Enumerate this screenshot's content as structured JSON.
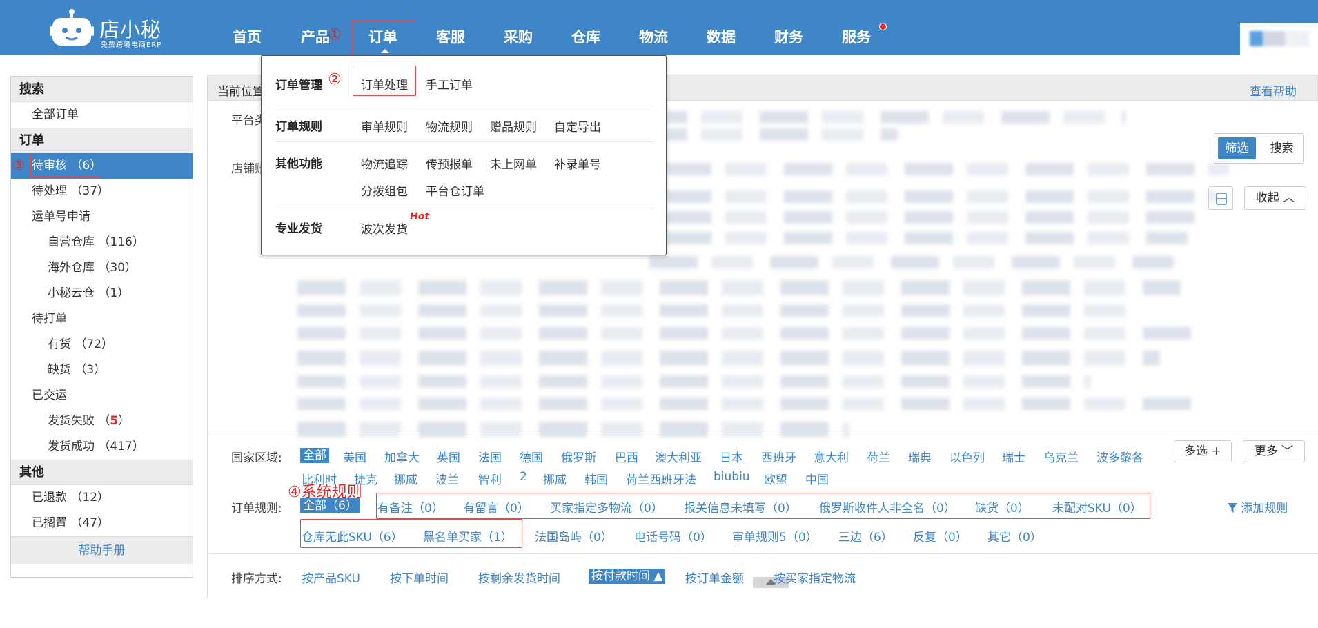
{
  "app": {
    "logo_title": "店小秘",
    "logo_subtitle": "免费跨境电商ERP"
  },
  "nav": {
    "items": [
      "首页",
      "产品",
      "订单",
      "客服",
      "采购",
      "仓库",
      "物流",
      "数据",
      "财务",
      "服务"
    ],
    "active": "订单"
  },
  "annotations": {
    "a1": "①",
    "a2": "②",
    "a3": "③",
    "a4": "④系统规则"
  },
  "dropdown": {
    "sections": [
      {
        "head": "订单管理",
        "links": [
          "订单处理",
          "手工订单"
        ]
      },
      {
        "head": "订单规则",
        "links": [
          "审单规则",
          "物流规则",
          "赠品规则",
          "自定导出"
        ]
      },
      {
        "head": "其他功能",
        "links": [
          "物流追踪",
          "传预报单",
          "未上网单",
          "补录单号",
          "分拨组包",
          "平台仓订单"
        ]
      },
      {
        "head": "专业发货",
        "links": [
          "波次发货"
        ]
      }
    ],
    "hot_badge": "Hot"
  },
  "sidebar": {
    "groups": [
      {
        "head": "搜索",
        "items": [
          {
            "label": "全部订单",
            "level": 1
          }
        ]
      },
      {
        "head": "订单",
        "items": [
          {
            "label": "待审核",
            "count": "（6）",
            "level": 1,
            "selected": true
          },
          {
            "label": "待处理",
            "count": "（37）",
            "level": 1
          },
          {
            "label": "运单号申请",
            "count": "",
            "level": 1
          },
          {
            "label": "自营仓库",
            "count": "（116）",
            "level": 2
          },
          {
            "label": "海外仓库",
            "count": "（30）",
            "level": 2
          },
          {
            "label": "小秘云仓",
            "count": "（1）",
            "level": 2
          },
          {
            "label": "待打单",
            "count": "",
            "level": 1
          },
          {
            "label": "有货",
            "count": "（72）",
            "level": 2
          },
          {
            "label": "缺货",
            "count": "（3）",
            "level": 2
          },
          {
            "label": "已交运",
            "count": "",
            "level": 1
          },
          {
            "label": "发货失败",
            "count": "5",
            "level": 2,
            "red": true
          },
          {
            "label": "发货成功",
            "count": "（417）",
            "level": 2
          }
        ]
      },
      {
        "head": "其他",
        "items": [
          {
            "label": "已退款",
            "count": "（12）",
            "level": 1
          },
          {
            "label": "已搁置",
            "count": "（47）",
            "level": 1
          }
        ]
      }
    ],
    "footer": "帮助手册"
  },
  "main": {
    "breadcrumb": "当前位置",
    "help_link": "查看帮助",
    "platform_label": "平台类",
    "shop_label": "店铺账",
    "filter_btn": "筛选",
    "search_btn": "搜索",
    "collapse_btn": "收起 ︿",
    "country_label": "国家区域:",
    "countries_row1": [
      "全部",
      "美国",
      "加拿大",
      "英国",
      "法国",
      "德国",
      "俄罗斯",
      "巴西",
      "澳大利亚",
      "日本",
      "西班牙",
      "意大利",
      "荷兰",
      "瑞典",
      "以色列",
      "瑞士",
      "乌克兰",
      "波多黎各"
    ],
    "countries_row2": [
      "比利时",
      "捷克",
      "挪威",
      "波兰",
      "智利",
      "2",
      "挪威",
      "韩国",
      "荷兰西班牙法",
      "biubiu",
      "欧盟",
      "中国"
    ],
    "multi_btn": "多选 +",
    "more_btn": "更多 ﹀",
    "rule_label": "订单规则:",
    "rules_row1": [
      "全部（6）",
      "有备注（0）",
      "有留言（0）",
      "买家指定多物流（0）",
      "报关信息未填写（0）",
      "俄罗斯收件人非全名（0）",
      "缺货（0）",
      "未配对SKU（0）"
    ],
    "rules_row2": [
      "仓库无此SKU（6）",
      "黑名单买家（1）",
      "法国岛屿（0）",
      "电话号码（0）",
      "审单规则5（0）",
      "三边（6）",
      "反复（0）",
      "其它（0）"
    ],
    "add_rule": "添加规则",
    "sort_label": "排序方式:",
    "sorts": [
      "按产品SKU",
      "按下单时间",
      "按剩余发货时间",
      "按付款时间 ▲",
      "按订单金额",
      "按买家指定物流"
    ],
    "sort_selected": "按付款时间 ▲"
  },
  "colors": {
    "brand": "#3f86c9",
    "annotation_red": "#e84646"
  }
}
